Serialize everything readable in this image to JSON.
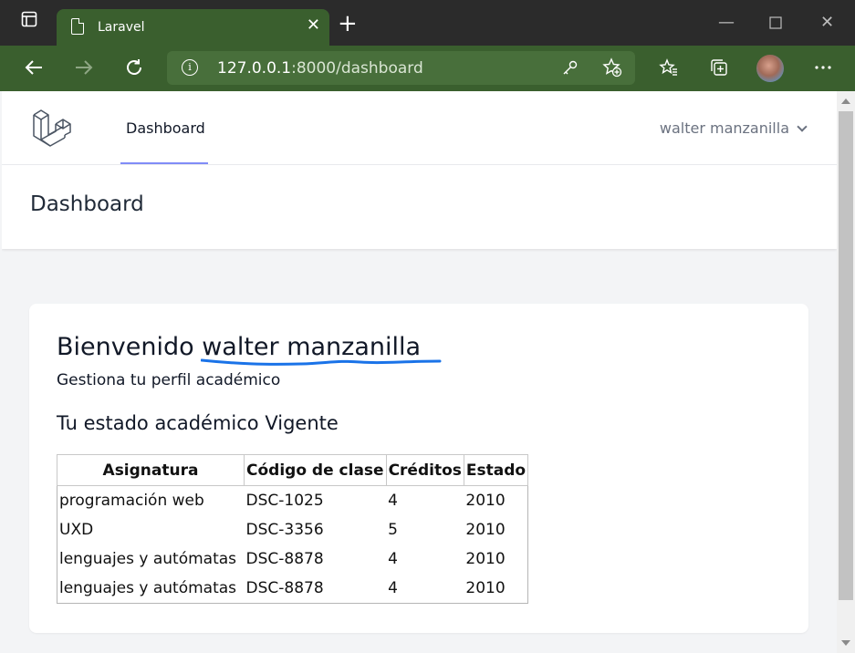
{
  "browser": {
    "tab_title": "Laravel",
    "url_host": "127.0.0.1",
    "url_rest": ":8000/dashboard"
  },
  "nav": {
    "link_label": "Dashboard",
    "user_name": "walter manzanilla"
  },
  "header": {
    "title": "Dashboard"
  },
  "card": {
    "welcome_prefix": "Bienvenido",
    "welcome_name": "walter manzanilla",
    "subtitle": "Gestiona tu perfil académico",
    "status_title": "Tu estado académico Vigente",
    "table": {
      "headers": [
        "Asignatura",
        "Código de clase",
        "Créditos",
        "Estado"
      ],
      "rows": [
        [
          "programación web",
          "DSC-1025",
          "4",
          "2010"
        ],
        [
          "UXD",
          "DSC-3356",
          "5",
          "2010"
        ],
        [
          "lenguajes y autómatas",
          "DSC-8878",
          "4",
          "2010"
        ],
        [
          "lenguajes y autómatas",
          "DSC-8878",
          "4",
          "2010"
        ]
      ]
    }
  },
  "colors": {
    "chrome_dark": "#2b2b2b",
    "chrome_green": "#3a5f2e",
    "address_bar": "#486f3b",
    "nav_active_underline": "#818cf8",
    "annotation_underline": "#1a73e8"
  },
  "icons": [
    "sidebar-toggle-icon",
    "document-icon",
    "close-icon",
    "plus-icon",
    "minimize-icon",
    "maximize-icon",
    "back-arrow-icon",
    "forward-arrow-icon",
    "refresh-icon",
    "info-icon",
    "key-icon",
    "favorite-add-icon",
    "favorites-icon",
    "collections-icon",
    "more-icon",
    "laravel-logo-icon",
    "chevron-down-icon"
  ]
}
